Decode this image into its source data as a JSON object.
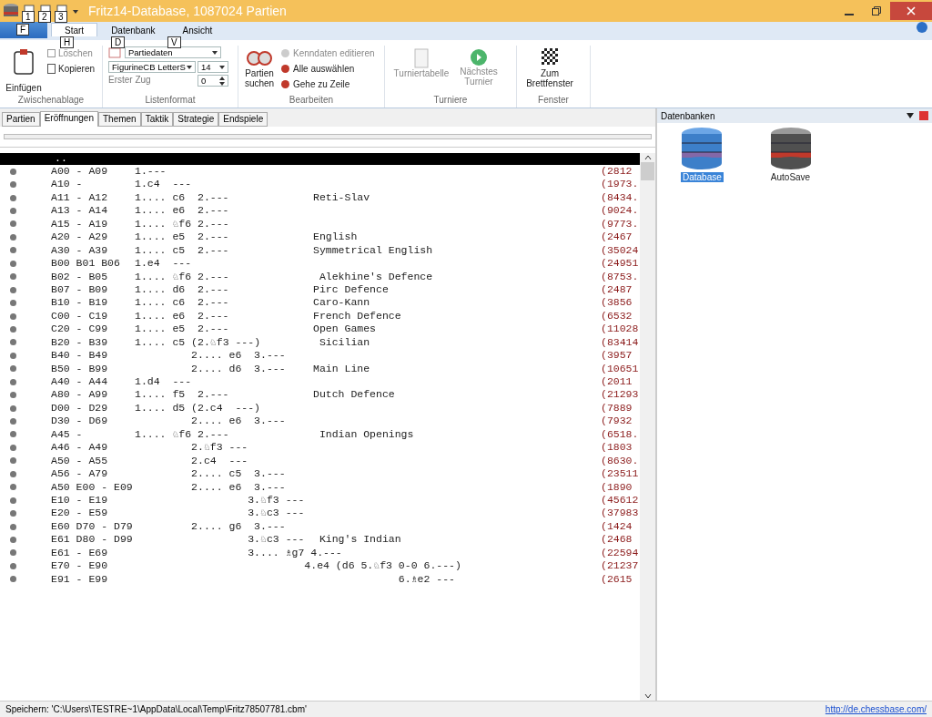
{
  "window": {
    "title": "Fritz14-Database,  1087024 Partien",
    "quick_access_keytips": [
      "1",
      "2",
      "3"
    ]
  },
  "ribbon_tabs": [
    {
      "label": "Start",
      "keytip": "H",
      "selected": true
    },
    {
      "label": "Datenbank",
      "keytip": "D",
      "selected": false
    },
    {
      "label": "Ansicht",
      "keytip": "V",
      "selected": false
    }
  ],
  "file_button": {
    "keytip": "F"
  },
  "ribbon": {
    "groups": [
      {
        "title": "Zwischenablage",
        "paste": "Einfügen",
        "delete": {
          "label": "Löschen",
          "disabled": true
        },
        "copy": {
          "label": "Kopieren",
          "disabled": false
        }
      },
      {
        "title": "Listenformat",
        "view_select": "Partiedaten",
        "font_select": "FigurineCB LetterS",
        "size_select": "14",
        "first_move_label": "Erster Zug",
        "first_move_value": "0"
      },
      {
        "title": "Bearbeiten",
        "search": "Partien suchen",
        "items": [
          {
            "label": "Kenndaten editieren",
            "disabled": true
          },
          {
            "label": "Alle auswählen",
            "disabled": false
          },
          {
            "label": "Gehe zu Zeile",
            "disabled": false
          }
        ]
      },
      {
        "title": "Turniere",
        "items": [
          {
            "label": "Turniertabelle",
            "disabled": true
          },
          {
            "label": "Nächstes Turnier",
            "disabled": true
          }
        ]
      },
      {
        "title": "Fenster",
        "items": [
          {
            "label": "Zum Brettfenster",
            "disabled": false
          }
        ]
      }
    ]
  },
  "doc_tabs": [
    {
      "label": "Partien",
      "selected": false
    },
    {
      "label": "Eröffnungen",
      "selected": true
    },
    {
      "label": "Themen",
      "selected": false
    },
    {
      "label": "Taktik",
      "selected": false
    },
    {
      "label": "Strategie",
      "selected": false
    },
    {
      "label": "Endspiele",
      "selected": false
    }
  ],
  "openings": {
    "header": "..",
    "rows": [
      {
        "code": "A00 - A09",
        "moves": "1.---",
        "name": "",
        "count": "(2812"
      },
      {
        "code": "A10 -",
        "moves": "1.c4  ---",
        "name": "",
        "count": "(1973."
      },
      {
        "code": "A11 - A12",
        "moves": "1.... c6  2.---",
        "name": "Reti-Slav",
        "count": "(8434."
      },
      {
        "code": "A13 - A14",
        "moves": "1.... e6  2.---",
        "name": "",
        "count": "(9024."
      },
      {
        "code": "A15 - A19",
        "moves": "1.... ♘f6 2.---",
        "name": "",
        "count": "(9773."
      },
      {
        "code": "A20 - A29",
        "moves": "1.... e5  2.---",
        "name": "English",
        "count": "(2467"
      },
      {
        "code": "A30 - A39",
        "moves": "1.... c5  2.---",
        "name": "Symmetrical English",
        "count": "(35024"
      },
      {
        "code": "B00 B01 B06",
        "moves": "1.e4  ---",
        "name": "",
        "count": "(24951"
      },
      {
        "code": "B02 - B05",
        "moves": "1.... ♘f6 2.---",
        "name": " Alekhine's Defence",
        "count": "(8753."
      },
      {
        "code": "B07 - B09",
        "moves": "1.... d6  2.---",
        "name": "Pirc Defence",
        "count": "(2487"
      },
      {
        "code": "B10 - B19",
        "moves": "1.... c6  2.---",
        "name": "Caro-Kann",
        "count": "(3856"
      },
      {
        "code": "C00 - C19",
        "moves": "1.... e6  2.---",
        "name": "French Defence",
        "count": "(6532"
      },
      {
        "code": "C20 - C99",
        "moves": "1.... e5  2.---",
        "name": "Open Games",
        "count": "(11028"
      },
      {
        "code": "B20 - B39",
        "moves": "1.... c5 (2.♘f3 ---)",
        "name": " Sicilian",
        "count": "(83414"
      },
      {
        "code": "B40 - B49",
        "moves": "         2.... e6  3.---",
        "name": "",
        "count": "(3957"
      },
      {
        "code": "B50 - B99",
        "moves": "         2.... d6  3.---",
        "name": "Main Line",
        "count": "(10651"
      },
      {
        "code": "A40 - A44",
        "moves": "1.d4  ---",
        "name": "",
        "count": "(2011"
      },
      {
        "code": "A80 - A99",
        "moves": "1.... f5  2.---",
        "name": "Dutch Defence",
        "count": "(21293"
      },
      {
        "code": "D00 - D29",
        "moves": "1.... d5 (2.c4  ---)",
        "name": "",
        "count": "(7889"
      },
      {
        "code": "D30 - D69",
        "moves": "         2.... e6  3.---",
        "name": "",
        "count": "(7932"
      },
      {
        "code": "A45 -",
        "moves": "1.... ♘f6 2.---",
        "name": " Indian Openings",
        "count": "(6518."
      },
      {
        "code": "A46 - A49",
        "moves": "         2.♘f3 ---",
        "name": "",
        "count": "(1803"
      },
      {
        "code": "A50 - A55",
        "moves": "         2.c4  ---",
        "name": "",
        "count": "(8630."
      },
      {
        "code": "A56 - A79",
        "moves": "         2.... c5  3.---",
        "name": "",
        "count": "(23511"
      },
      {
        "code": "A50 E00 - E09",
        "moves": "         2.... e6  3.---",
        "name": "",
        "count": "(1890"
      },
      {
        "code": "E10 - E19",
        "moves": "                  3.♘f3 ---",
        "name": "",
        "count": "(45612"
      },
      {
        "code": "E20 - E59",
        "moves": "                  3.♘c3 ---",
        "name": "",
        "count": "(37983"
      },
      {
        "code": "E60 D70 - D79",
        "moves": "         2.... g6  3.---",
        "name": "",
        "count": "(1424"
      },
      {
        "code": "E61 D80 - D99",
        "moves": "                  3.♘c3 ---",
        "name": " King's Indian",
        "count": "(2468"
      },
      {
        "code": "E61 - E69",
        "moves": "                  3.... ♗g7 4.---",
        "name": "",
        "count": "(22594"
      },
      {
        "code": "E70 - E90",
        "moves": "                           4.e4 (d6 5.♘f3 0-0 6.---)",
        "name": "",
        "count": "(21237"
      },
      {
        "code": "E91 - E99",
        "moves": "                                          6.♗e2 ---",
        "name": "",
        "count": "(2615"
      }
    ]
  },
  "databases_panel": {
    "title": "Datenbanken",
    "items": [
      {
        "label": "Database",
        "kind": "blue",
        "selected": true
      },
      {
        "label": "AutoSave",
        "kind": "grey",
        "selected": false
      }
    ]
  },
  "status_bar": {
    "text": "Speichern: 'C:\\Users\\TESTRE~1\\AppData\\Local\\Temp\\Fritz78507781.cbm'",
    "link": "http://de.chessbase.com/"
  }
}
